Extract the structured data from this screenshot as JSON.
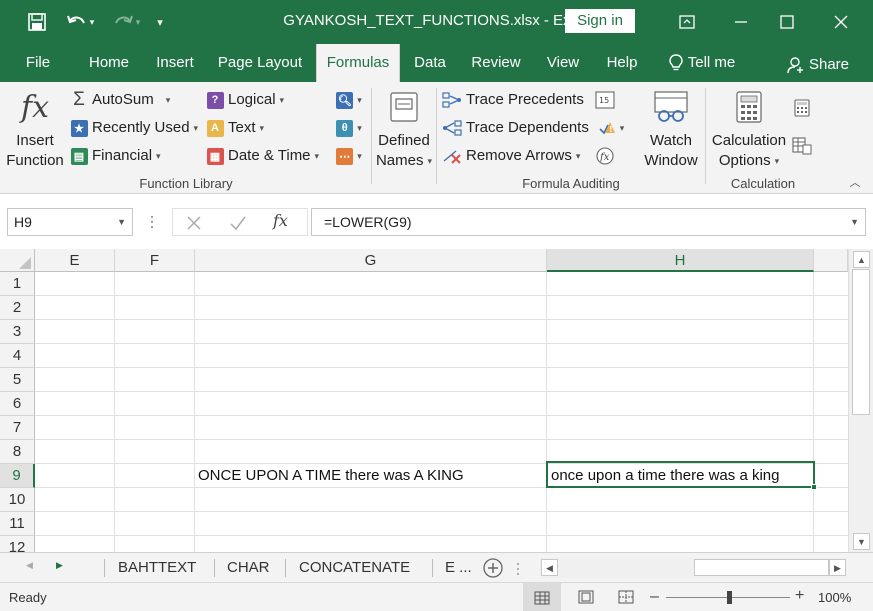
{
  "titlebar": {
    "title": "GYANKOSH_TEXT_FUNCTIONS.xlsx  -  Excel",
    "sign_in": "Sign in",
    "window_controls": [
      "minimize",
      "maximize",
      "close"
    ]
  },
  "tabs": {
    "file": "File",
    "home": "Home",
    "insert": "Insert",
    "page_layout": "Page Layout",
    "formulas": "Formulas",
    "data": "Data",
    "review": "Review",
    "view": "View",
    "help": "Help",
    "tell_me": "Tell me",
    "share": "Share"
  },
  "ribbon": {
    "insert_function_line1": "Insert",
    "insert_function_line2": "Function",
    "autosum": "AutoSum",
    "recently_used": "Recently Used",
    "financial": "Financial",
    "logical": "Logical",
    "text": "Text",
    "date_time": "Date & Time",
    "function_library": "Function Library",
    "defined_names_line1": "Defined",
    "defined_names_line2": "Names",
    "trace_precedents": "Trace Precedents",
    "trace_dependents": "Trace Dependents",
    "remove_arrows": "Remove Arrows",
    "formula_auditing": "Formula Auditing",
    "watch_window_line1": "Watch",
    "watch_window_line2": "Window",
    "calc_options_line1": "Calculation",
    "calc_options_line2": "Options",
    "calculation": "Calculation"
  },
  "formula_bar": {
    "name_box": "H9",
    "fx": "fx",
    "formula": "=LOWER(G9)"
  },
  "grid": {
    "columns": [
      "E",
      "F",
      "G",
      "H"
    ],
    "rows": [
      "1",
      "2",
      "3",
      "4",
      "5",
      "6",
      "7",
      "8",
      "9",
      "10",
      "11",
      "12"
    ],
    "g9": "ONCE UPON A TIME there was  A KING",
    "h9": "once upon a time there was  a king"
  },
  "sheet_tabs": [
    "BAHTTEXT",
    "CHAR",
    "CONCATENATE",
    "E ..."
  ],
  "status": {
    "ready": "Ready",
    "zoom": "100%"
  },
  "colors": {
    "excel_green": "#217346",
    "ribbon_bg": "#f3f3f3"
  }
}
